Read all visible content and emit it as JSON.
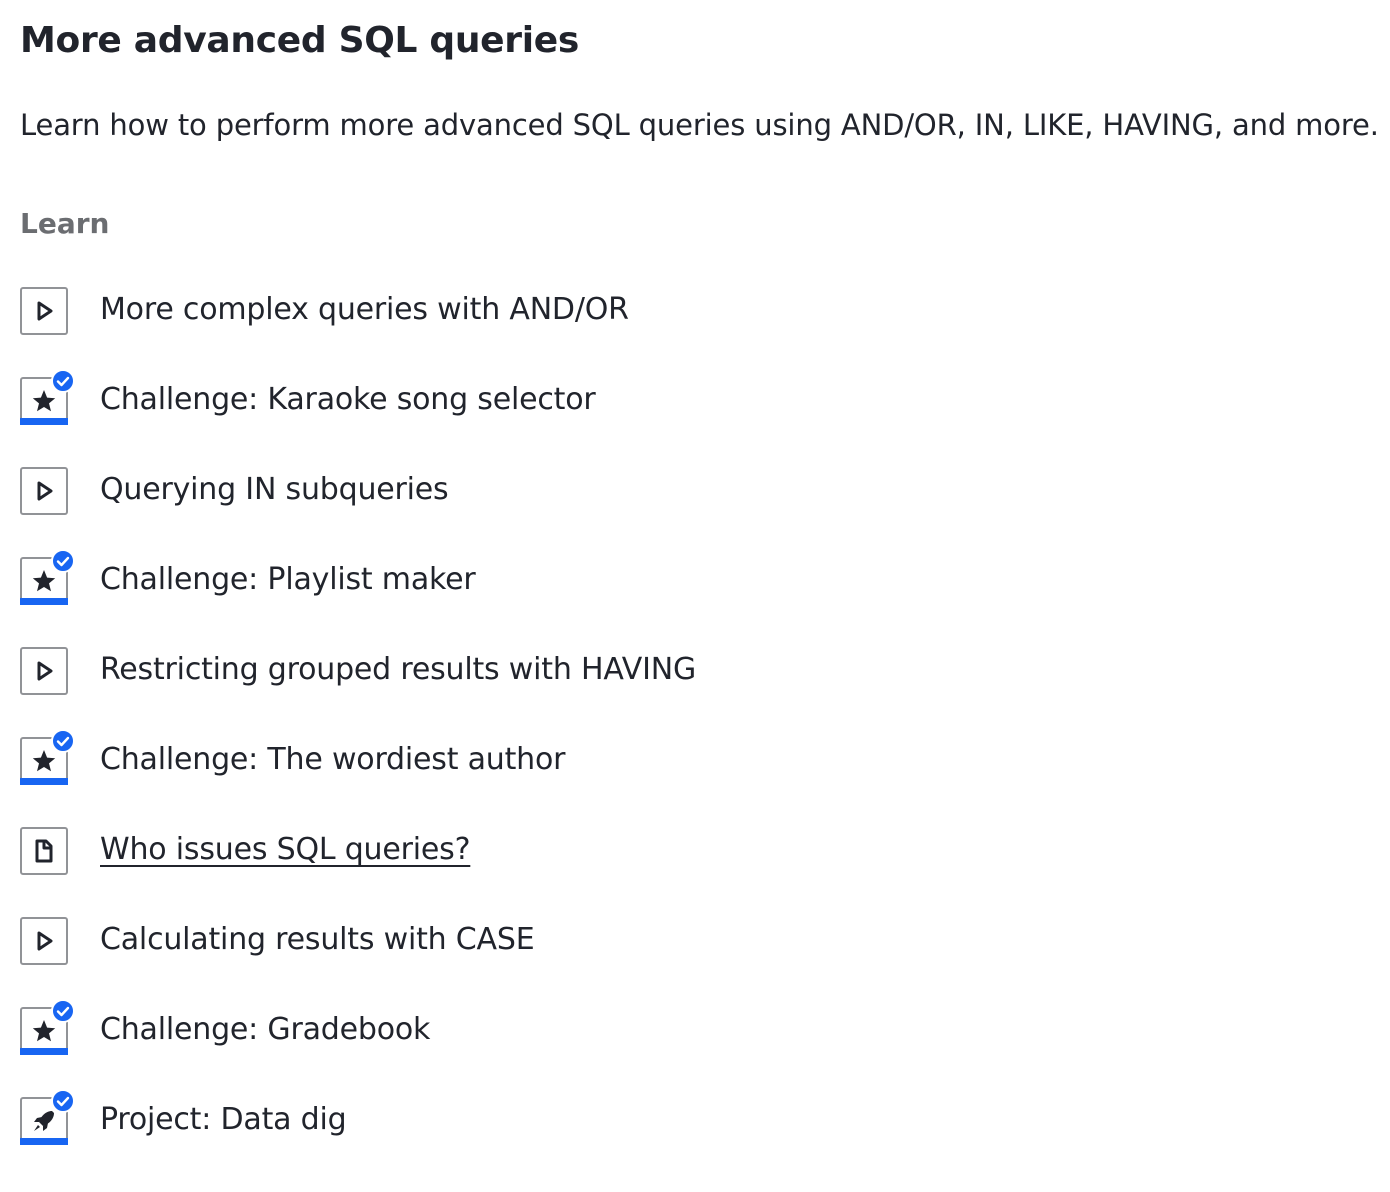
{
  "unit": {
    "title": "More advanced SQL queries",
    "description": "Learn how to perform more advanced SQL queries using AND/OR, IN, LIKE, HAVING, and more.",
    "section_label": "Learn"
  },
  "colors": {
    "text": "#21242c",
    "muted": "#6b6d71",
    "accent": "#1865f2",
    "icon_border": "#919397"
  },
  "items": [
    {
      "label": "More complex queries with AND/OR",
      "icon": "play-icon",
      "completed": false
    },
    {
      "label": "Challenge: Karaoke song selector",
      "icon": "star-icon",
      "completed": true
    },
    {
      "label": "Querying IN subqueries",
      "icon": "play-icon",
      "completed": false
    },
    {
      "label": "Challenge: Playlist maker",
      "icon": "star-icon",
      "completed": true
    },
    {
      "label": "Restricting grouped results with HAVING",
      "icon": "play-icon",
      "completed": false
    },
    {
      "label": "Challenge: The wordiest author",
      "icon": "star-icon",
      "completed": true
    },
    {
      "label": "Who issues SQL queries?",
      "icon": "article-icon",
      "completed": false
    },
    {
      "label": "Calculating results with CASE",
      "icon": "play-icon",
      "completed": false
    },
    {
      "label": "Challenge: Gradebook",
      "icon": "star-icon",
      "completed": true
    },
    {
      "label": "Project: Data dig",
      "icon": "rocket-icon",
      "completed": true
    }
  ]
}
